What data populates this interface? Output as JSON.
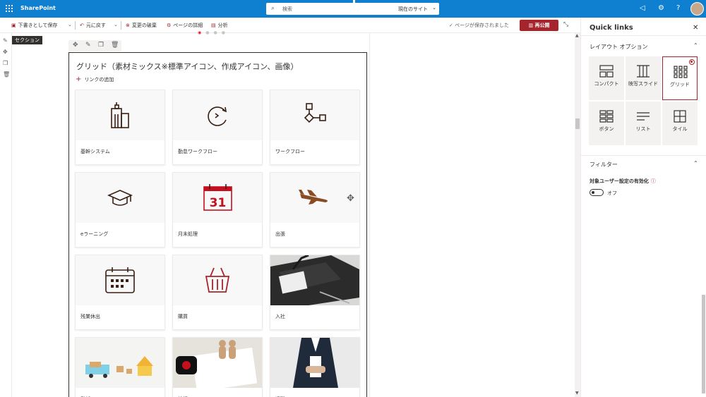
{
  "app": {
    "brand": "SharePoint"
  },
  "search": {
    "placeholder": "検索",
    "scope": "現在のサイト"
  },
  "commands": {
    "save_draft": "下書きとして保存",
    "undo": "元に戻す",
    "discard": "変更の破棄",
    "page_details": "ページの詳細",
    "analytics": "分析",
    "saved_status": "ページが保存されました",
    "republish": "再公開"
  },
  "canvas": {
    "section_tag": "セクション"
  },
  "webpart": {
    "title": "グリッド（素材ミックス※標準アイコン、作成アイコン、画像）",
    "add_link": "リンクの追加",
    "tiles": [
      {
        "label": "基幹システム",
        "icon": "building-icon"
      },
      {
        "label": "勤怠ワークフロー",
        "icon": "circular-arrow-icon"
      },
      {
        "label": "ワークフロー",
        "icon": "flowchart-icon"
      },
      {
        "label": "eラーニング",
        "icon": "graduation-cap-icon"
      },
      {
        "label": "月末処理",
        "icon": "calendar-icon",
        "text": "31"
      },
      {
        "label": "出張",
        "icon": "airplane-icon"
      },
      {
        "label": "残業休出",
        "icon": "calendar-grid-icon"
      },
      {
        "label": "購買",
        "icon": "shopping-basket-icon"
      },
      {
        "label": "入社",
        "icon": "staff-badge-photo"
      },
      {
        "label": "引越",
        "icon": "moving-truck-photo"
      },
      {
        "label": "結婚",
        "icon": "wedding-document-photo"
      },
      {
        "label": "退職",
        "icon": "resignation-letter-photo"
      }
    ]
  },
  "panel": {
    "title": "Quick links",
    "layout_header": "レイアウト オプション",
    "layouts": [
      {
        "label": "コンパクト",
        "selected": false
      },
      {
        "label": "映写スライド",
        "selected": false
      },
      {
        "label": "グリッド",
        "selected": true
      },
      {
        "label": "ボタン",
        "selected": false
      },
      {
        "label": "リスト",
        "selected": false
      },
      {
        "label": "タイル",
        "selected": false
      }
    ],
    "filter_header": "フィルター",
    "audience_label": "対象ユーザー設定の有効化",
    "toggle_state": "オフ"
  },
  "colors": {
    "suite_bar": "#0f7fd0",
    "accent": "#a4262c",
    "tile_icon": "#3b1f12",
    "calendar_red": "#c50f1f"
  }
}
